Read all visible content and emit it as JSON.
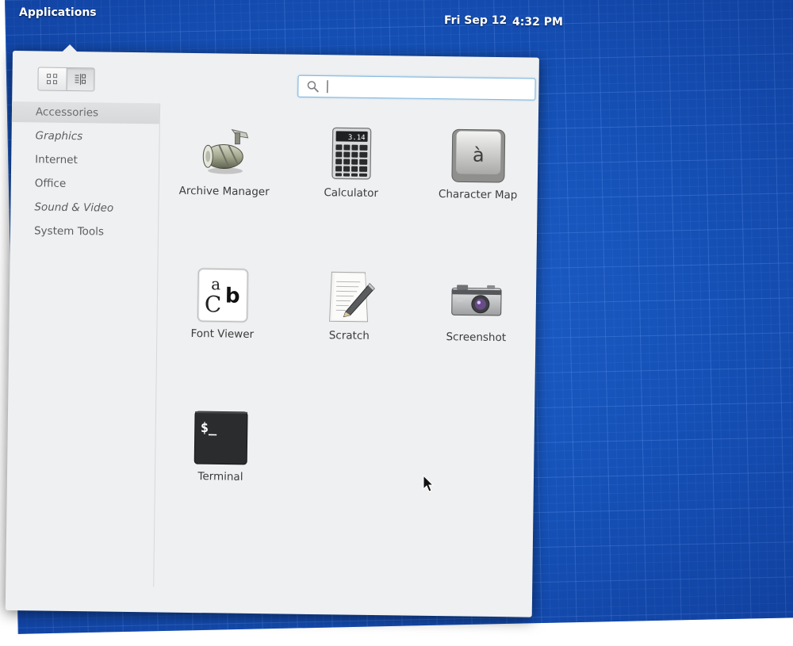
{
  "panel": {
    "applications_label": "Applications",
    "date": "Fri Sep 12",
    "time": "4:32 PM"
  },
  "view_toggle": {
    "grid_icon": "grid-view-icon",
    "category_icon": "category-view-icon"
  },
  "search": {
    "value": "",
    "placeholder": "",
    "icon": "search-icon"
  },
  "sidebar": {
    "items": [
      {
        "label": "Accessories",
        "selected": true
      },
      {
        "label": "Graphics",
        "selected": false
      },
      {
        "label": "Internet",
        "selected": false
      },
      {
        "label": "Office",
        "selected": false
      },
      {
        "label": "Sound & Video",
        "selected": false
      },
      {
        "label": "System Tools",
        "selected": false
      }
    ]
  },
  "apps": [
    {
      "label": "Archive Manager",
      "icon": "archive-manager-icon"
    },
    {
      "label": "Calculator",
      "icon": "calculator-icon",
      "icon_text": "3.14"
    },
    {
      "label": "Character Map",
      "icon": "character-map-icon",
      "icon_text": "à"
    },
    {
      "label": "Font Viewer",
      "icon": "font-viewer-icon"
    },
    {
      "label": "Scratch",
      "icon": "scratch-icon"
    },
    {
      "label": "Screenshot",
      "icon": "screenshot-icon"
    },
    {
      "label": "Terminal",
      "icon": "terminal-icon",
      "icon_text": "$_"
    }
  ],
  "colors": {
    "desktop_blue": "#1552b8",
    "popover_bg": "#eff0f1",
    "search_focus": "#7fb6df"
  }
}
